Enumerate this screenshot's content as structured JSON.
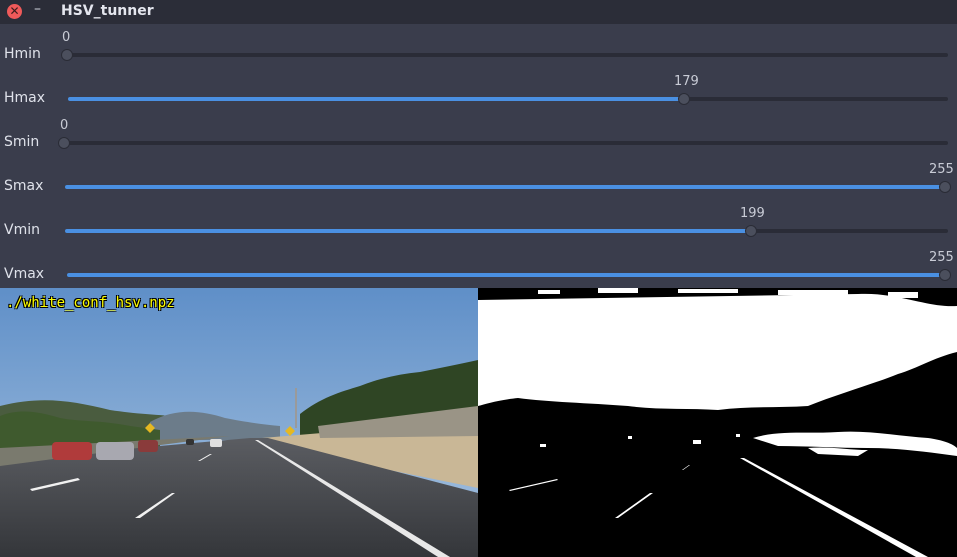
{
  "window": {
    "title": "HSV_tunner",
    "close_glyph": "✕",
    "min_glyph": "–"
  },
  "sliders": [
    {
      "label": "Hmin",
      "value": "0",
      "fraction": 0.0
    },
    {
      "label": "Hmax",
      "value": "179",
      "fraction": 0.7
    },
    {
      "label": "Smin",
      "value": "0",
      "fraction": 0.0
    },
    {
      "label": "Smax",
      "value": "255",
      "fraction": 1.0
    },
    {
      "label": "Vmin",
      "value": "199",
      "fraction": 0.78
    },
    {
      "label": "Vmax",
      "value": "255",
      "fraction": 1.0
    }
  ],
  "image": {
    "overlay_text": "./white_conf_hsv.npz"
  },
  "colors": {
    "accent": "#4a90e2",
    "close": "#ef5a5a",
    "overlay": "#ffff00"
  }
}
